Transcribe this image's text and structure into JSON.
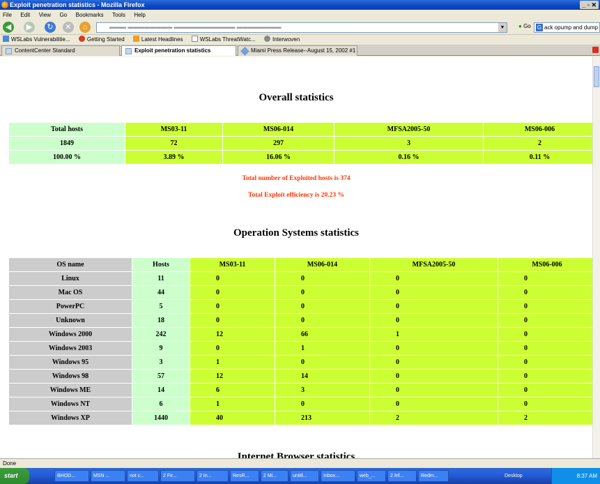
{
  "window": {
    "title": "Exploit penetration statistics - Mozilla Firefox",
    "controls": "_ ▫ ✕"
  },
  "menu": [
    "File",
    "Edit",
    "View",
    "Go",
    "Bookmarks",
    "Tools",
    "Help"
  ],
  "nav": {
    "go_label": "Go",
    "search_value": "ack opump and dump"
  },
  "bookmarks": [
    "WSLabs Vulnerabilitie...",
    "Getting Started",
    "Latest Headlines",
    "WSLabs ThreatWatc...",
    "Interwoven"
  ],
  "tabs": [
    {
      "label": "ContentCenter Standard"
    },
    {
      "label": "Exploit penetration statistics"
    },
    {
      "label": "Miami Press Release--August 15, 2002 #1"
    }
  ],
  "overall": {
    "heading": "Overall statistics",
    "headers": [
      "Total hosts",
      "MS03-11",
      "MS06-014",
      "MFSA2005-50",
      "MS06-006"
    ],
    "counts": [
      "1849",
      "72",
      "297",
      "3",
      "2"
    ],
    "percents": [
      "100.00 %",
      "3.89 %",
      "16.06 %",
      "0.16 %",
      "0.11 %"
    ],
    "exploited_text": "Total number of Exploited hosts is 374",
    "efficiency_text": "Total Exploit efficiency is 20.23 %"
  },
  "os": {
    "heading": "Operation Systems statistics",
    "headers": [
      "OS name",
      "Hosts",
      "MS03-11",
      "MS06-014",
      "MFSA2005-50",
      "MS06-006"
    ],
    "rows": [
      [
        "Linux",
        "11",
        "0",
        "0",
        "0",
        "0"
      ],
      [
        "Mac OS",
        "44",
        "0",
        "0",
        "0",
        "0"
      ],
      [
        "PowerPC",
        "5",
        "0",
        "0",
        "0",
        "0"
      ],
      [
        "Unknown",
        "18",
        "0",
        "0",
        "0",
        "0"
      ],
      [
        "Windows 2000",
        "242",
        "12",
        "66",
        "1",
        "0"
      ],
      [
        "Windows 2003",
        "9",
        "0",
        "1",
        "0",
        "0"
      ],
      [
        "Windows 95",
        "3",
        "1",
        "0",
        "0",
        "0"
      ],
      [
        "Windows 98",
        "57",
        "12",
        "14",
        "0",
        "0"
      ],
      [
        "Windows ME",
        "14",
        "6",
        "3",
        "0",
        "0"
      ],
      [
        "Windows NT",
        "6",
        "1",
        "0",
        "0",
        "0"
      ],
      [
        "Windows XP",
        "1440",
        "40",
        "213",
        "2",
        "2"
      ]
    ]
  },
  "browser": {
    "heading": "Internet Browser statistics"
  },
  "status": "Done",
  "taskbar": {
    "start": "start",
    "items": [
      "BHOD...",
      "MSN ...",
      "not c...",
      "2 Fir...",
      "2 In...",
      "ResR...",
      "2 Mi...",
      "untitl...",
      "Inbox...",
      "web_...",
      "2 Inf...",
      "Redm..."
    ],
    "desktop": "Desktop",
    "clock": "8:37 AM"
  },
  "colors": {
    "light_green": "#ccffcc",
    "lime": "#ccff33",
    "grey": "#cccccc",
    "red_text": "#ff3300"
  }
}
